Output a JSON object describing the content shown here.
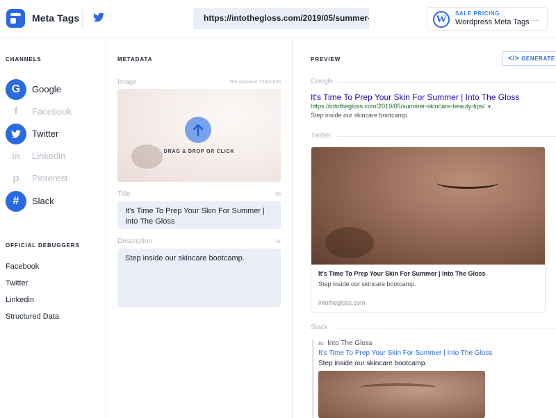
{
  "header": {
    "brand": "Meta Tags",
    "url": "https://intothegloss.com/2019/05/summer-",
    "sale_label": "SALE PRICING",
    "sale_title": "Wordpress Meta Tags"
  },
  "sidebar": {
    "channels_heading": "CHANNELS",
    "channels": [
      {
        "label": "Google",
        "active": true,
        "icon": "G"
      },
      {
        "label": "Facebook",
        "active": false,
        "icon": "f"
      },
      {
        "label": "Twitter",
        "active": true,
        "icon": "twitter"
      },
      {
        "label": "Linkedin",
        "active": false,
        "icon": "in"
      },
      {
        "label": "Pinterest",
        "active": false,
        "icon": "p"
      },
      {
        "label": "Slack",
        "active": true,
        "icon": "#"
      }
    ],
    "debuggers_heading": "OFFICIAL DEBUGGERS",
    "debuggers": [
      "Facebook",
      "Twitter",
      "Linkedin",
      "Structured Data"
    ]
  },
  "metadata": {
    "heading": "METADATA",
    "image_label": "Image",
    "image_recommend": "Recommend 1200×628",
    "drop_text": "DRAG & DROP OR CLICK",
    "title_label": "Title",
    "title_count": "55",
    "title_value": "It's Time To Prep Your Skin For Summer | Into The Gloss",
    "description_label": "Description",
    "description_count": "34",
    "description_value": "Step inside our skincare bootcamp."
  },
  "preview": {
    "heading": "PREVIEW",
    "generate_label": "GENERATE M",
    "google_label": "Google",
    "google_title": "It's Time To Prep Your Skin For Summer | Into The Gloss",
    "google_url": "https://intothegloss.com/2019/05/summer-skincare-beauty-tips/",
    "google_desc": "Step inside our skincare bootcamp.",
    "twitter_label": "Twitter",
    "twitter_title": "It's Time To Prep Your Skin For Summer | Into The Gloss",
    "twitter_desc": "Step inside our skincare bootcamp.",
    "twitter_domain": "intothegloss.com",
    "slack_label": "Slack",
    "slack_site": "Into The Gloss",
    "slack_favicon": "itc",
    "slack_title": "It's Time To Prep Your Skin For Summer | Into The Gloss",
    "slack_desc": "Step inside our skincare bootcamp."
  },
  "colors": {
    "accent": "#2a6ae1",
    "input_bg": "#e9eef8"
  }
}
